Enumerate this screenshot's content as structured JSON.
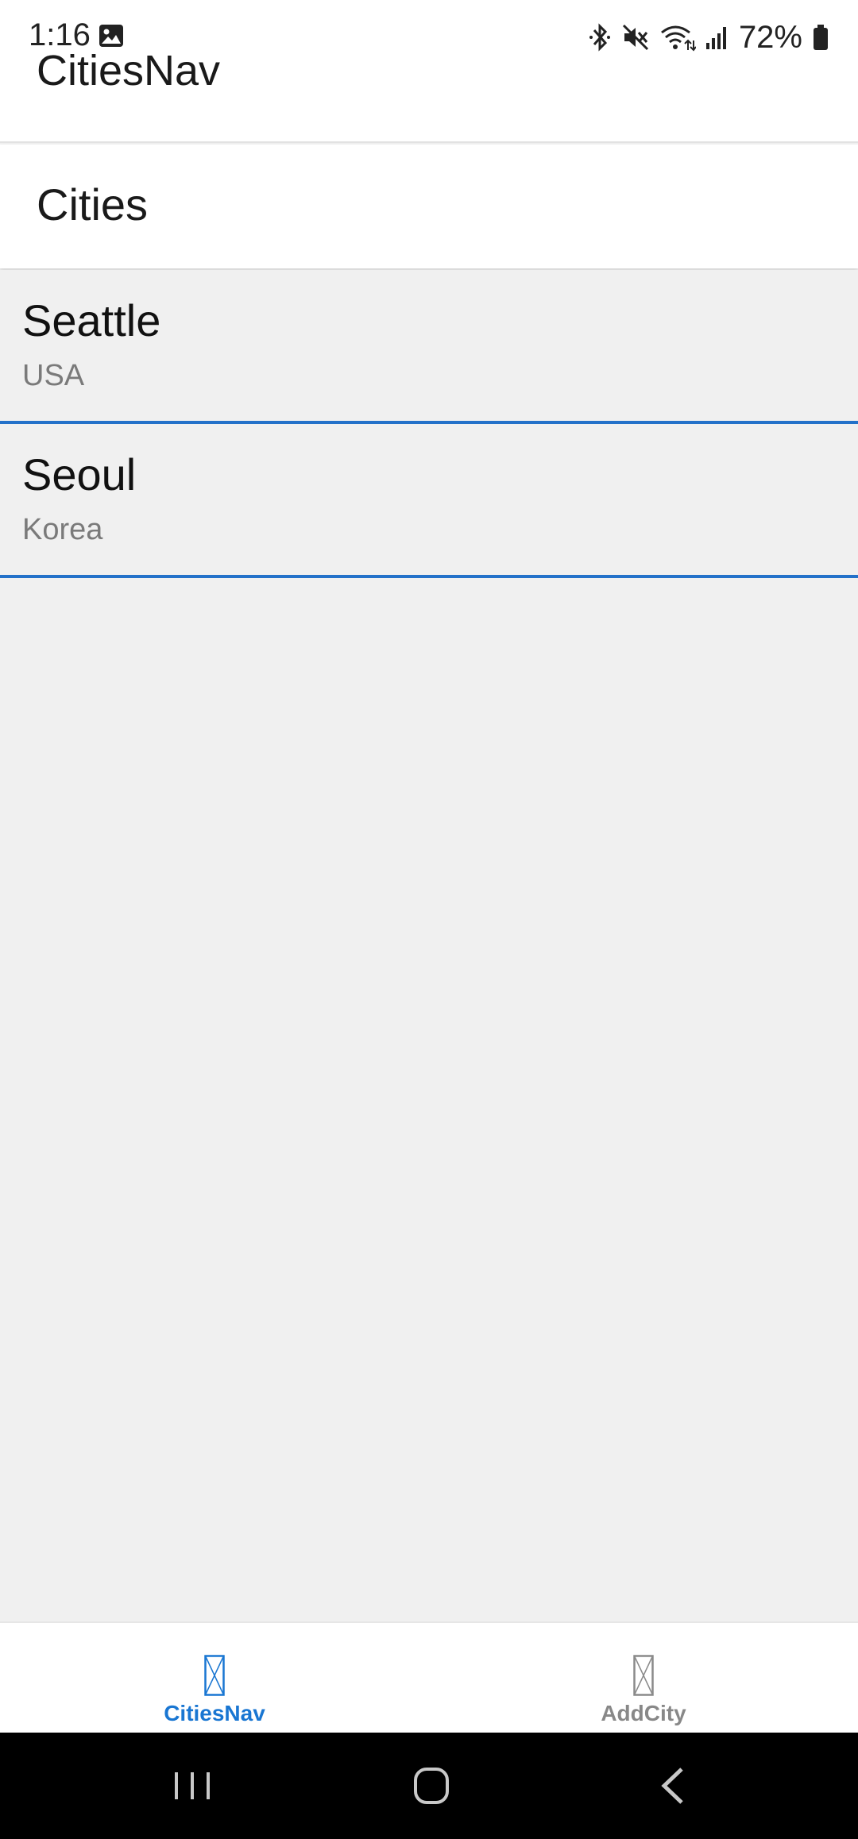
{
  "status_bar": {
    "time": "1:16",
    "battery": "72%",
    "icons": [
      "image-icon",
      "bluetooth-icon",
      "mute-icon",
      "wifi-icon",
      "signal-icon",
      "battery-icon"
    ]
  },
  "app_bar": {
    "title": "CitiesNav"
  },
  "page": {
    "title": "Cities"
  },
  "cities": [
    {
      "name": "Seattle",
      "country": "USA"
    },
    {
      "name": "Seoul",
      "country": "Korea"
    }
  ],
  "tabs": [
    {
      "label": "CitiesNav",
      "active": true
    },
    {
      "label": "AddCity",
      "active": false
    }
  ],
  "colors": {
    "accent": "#2371c9",
    "tab_active": "#1976d2",
    "tab_inactive": "#888888",
    "background": "#f0f0f0"
  },
  "nav_bar": {
    "icons": [
      "recents-icon",
      "home-icon",
      "back-icon"
    ]
  }
}
